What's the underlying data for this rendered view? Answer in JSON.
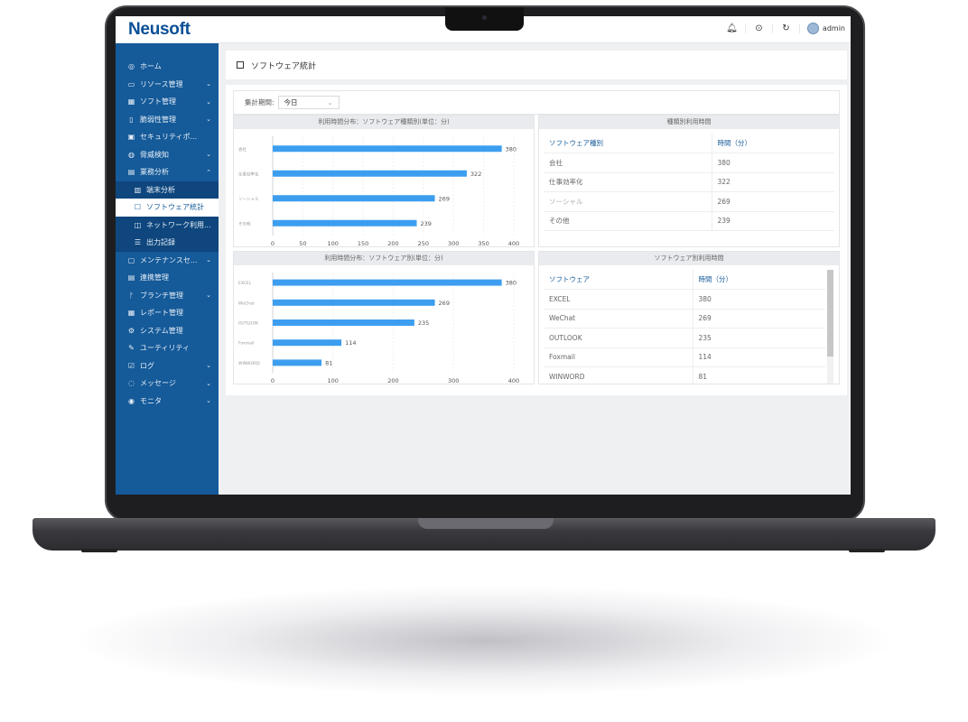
{
  "app": {
    "logo": "Neusoft",
    "user": "admin"
  },
  "topbar": {
    "icons": [
      "bell-icon",
      "help-icon",
      "refresh-icon",
      "avatar-icon"
    ]
  },
  "sidebar": {
    "items": [
      {
        "icon": "◎",
        "label": "ホーム",
        "chevron": ""
      },
      {
        "icon": "▭",
        "label": "リソース管理",
        "chevron": "⌄"
      },
      {
        "icon": "▦",
        "label": "ソフト管理",
        "chevron": "⌄"
      },
      {
        "icon": "▯",
        "label": "脆弱性管理",
        "chevron": "⌄"
      },
      {
        "icon": "▣",
        "label": "セキュリティポ...",
        "chevron": ""
      },
      {
        "icon": "◍",
        "label": "脅威検知",
        "chevron": "⌄"
      },
      {
        "icon": "▤",
        "label": "業務分析",
        "chevron": "⌃"
      },
      {
        "icon": "▥",
        "label": "端末分析",
        "chevron": ""
      },
      {
        "icon": "☐",
        "label": "ソフトウェア統計",
        "chevron": ""
      },
      {
        "icon": "◫",
        "label": "ネットワーク利用...",
        "chevron": ""
      },
      {
        "icon": "☰",
        "label": "出力記録",
        "chevron": ""
      },
      {
        "icon": "▢",
        "label": "メンテナンスセ...",
        "chevron": "⌄"
      },
      {
        "icon": "▤",
        "label": "連携管理",
        "chevron": ""
      },
      {
        "icon": "ᚠ",
        "label": "ブランチ管理",
        "chevron": "⌄"
      },
      {
        "icon": "▦",
        "label": "レポート管理",
        "chevron": ""
      },
      {
        "icon": "⚙",
        "label": "システム管理",
        "chevron": ""
      },
      {
        "icon": "✎",
        "label": "ユーティリティ",
        "chevron": ""
      },
      {
        "icon": "☑",
        "label": "ログ",
        "chevron": "⌄"
      },
      {
        "icon": "◌",
        "label": "メッセージ",
        "chevron": "⌄"
      },
      {
        "icon": "◉",
        "label": "モニタ",
        "chevron": "⌄"
      }
    ]
  },
  "page": {
    "title": "ソフトウェア統計"
  },
  "filter": {
    "label": "集計期間:",
    "value": "今日"
  },
  "table1": {
    "title": "種類別利用時間",
    "headers": [
      "ソフトウェア種別",
      "時間（分）"
    ],
    "rows": [
      [
        "会社",
        "380"
      ],
      [
        "仕事効率化",
        "322"
      ],
      [
        "ソーシャル",
        "269"
      ],
      [
        "その他",
        "239"
      ]
    ]
  },
  "table2": {
    "title": "ソフトウェア別利用時間",
    "headers": [
      "ソフトウェア",
      "時間（分）"
    ],
    "rows": [
      [
        "EXCEL",
        "380"
      ],
      [
        "WeChat",
        "269"
      ],
      [
        "OUTLOOK",
        "235"
      ],
      [
        "Foxmail",
        "114"
      ],
      [
        "WINWORD",
        "81"
      ]
    ]
  },
  "chart_data": [
    {
      "type": "bar",
      "orientation": "horizontal",
      "title": "利用時間分布：ソフトウェア種類別(単位：分)",
      "categories": [
        "会社",
        "仕事効率化",
        "ソーシャル",
        "その他"
      ],
      "values": [
        380,
        322,
        269,
        239
      ],
      "xlim": [
        0,
        400
      ],
      "xticks": [
        0,
        50,
        100,
        150,
        200,
        250,
        300,
        350,
        400
      ],
      "color": "#3d9ef0"
    },
    {
      "type": "bar",
      "orientation": "horizontal",
      "title": "利用時間分布：ソフトウェア別(単位：分)",
      "categories": [
        "EXCEL",
        "WeChat",
        "OUTLOOK",
        "Foxmail",
        "WINWORD"
      ],
      "values": [
        380,
        269,
        235,
        114,
        81
      ],
      "xlim": [
        0,
        400
      ],
      "xticks": [
        0,
        100,
        200,
        300,
        400
      ],
      "color": "#3d9ef0"
    }
  ]
}
